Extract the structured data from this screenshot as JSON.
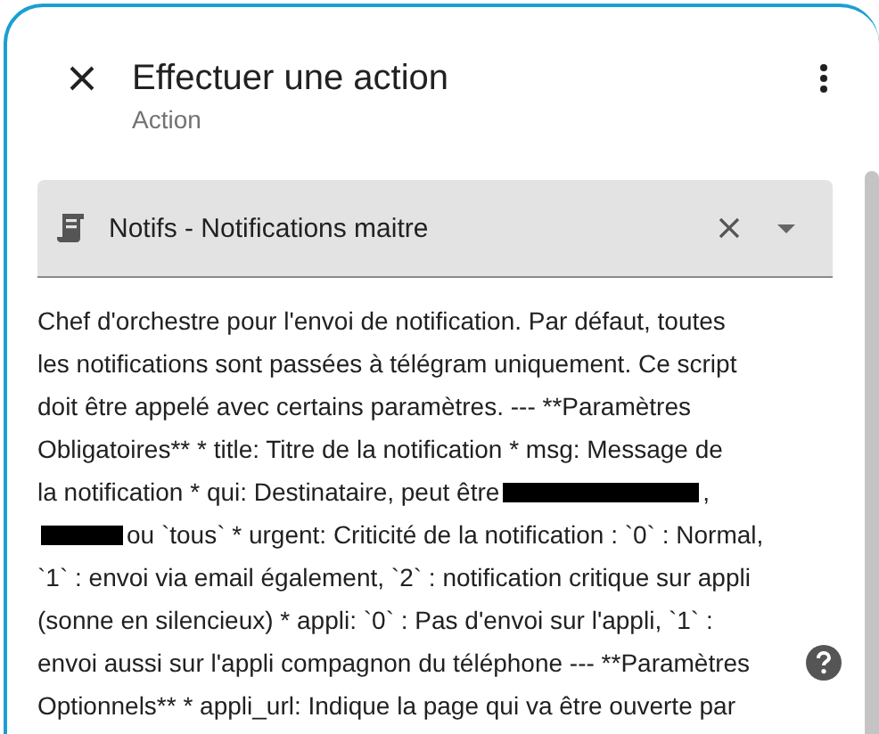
{
  "dialog": {
    "title": "Effectuer une action",
    "subtitle": "Action"
  },
  "action_select": {
    "value": "Notifs - Notifications maitre"
  },
  "description_lines": [
    [
      {
        "kind": "text",
        "text": "Chef d'orchestre pour l'envoi de notification. Par défaut, toutes"
      }
    ],
    [
      {
        "kind": "text",
        "text": "les notifications sont passées à télégram uniquement. Ce script"
      }
    ],
    [
      {
        "kind": "text",
        "text": "doit être appelé avec certains paramètres. --- **Paramètres"
      }
    ],
    [
      {
        "kind": "text",
        "text": "Obligatoires** * title: Titre de la notification * msg: Message de"
      }
    ],
    [
      {
        "kind": "text",
        "text": "la notification * qui: Destinataire, peut être"
      },
      {
        "kind": "redacted"
      },
      {
        "kind": "text",
        "text": ","
      }
    ],
    [
      {
        "kind": "redacted"
      },
      {
        "kind": "text",
        "text": "ou `tous` * urgent: Criticité de la notification : `0` : Normal,"
      }
    ],
    [
      {
        "kind": "text",
        "text": "`1` : envoi via email également, `2` : notification critique sur appli"
      }
    ],
    [
      {
        "kind": "text",
        "text": "(sonne en silencieux) * appli: `0` : Pas d'envoi sur l'appli, `1` :"
      }
    ],
    [
      {
        "kind": "text",
        "text": "envoi aussi sur l'appli compagnon du téléphone --- **Paramètres"
      }
    ],
    [
      {
        "kind": "text",
        "text": "Optionnels** * appli_url: Indique la page qui va être ouverte par"
      }
    ]
  ]
}
